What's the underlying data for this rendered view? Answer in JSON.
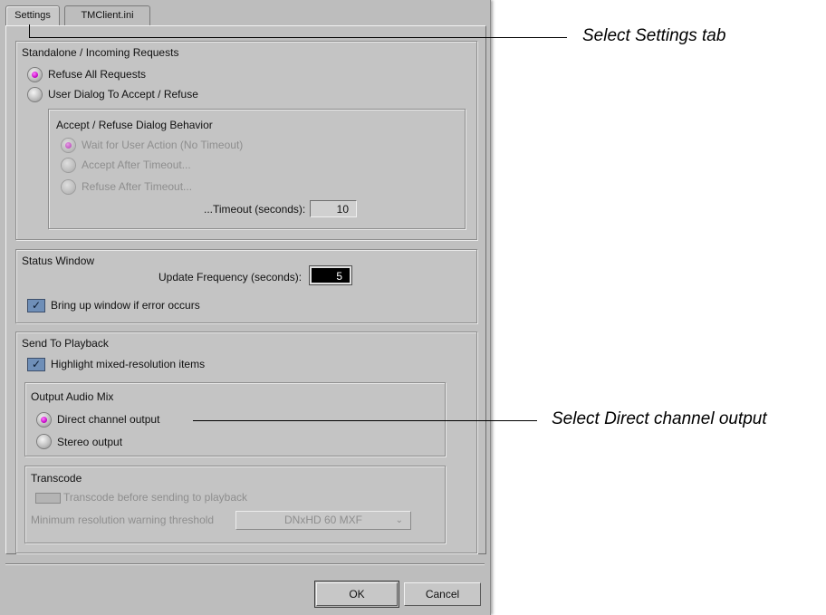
{
  "tabs": [
    {
      "label": "Settings",
      "active": true
    },
    {
      "label": "TMClient.ini",
      "active": false
    }
  ],
  "standalone": {
    "title": "Standalone / Incoming Requests",
    "options": [
      {
        "label": "Refuse All Requests",
        "selected": true
      },
      {
        "label": "User Dialog To Accept / Refuse",
        "selected": false
      }
    ],
    "dialog_behavior": {
      "title": "Accept / Refuse Dialog Behavior",
      "options": [
        {
          "label": "Wait for User Action (No Timeout)",
          "selected": true
        },
        {
          "label": "Accept After Timeout...",
          "selected": false
        },
        {
          "label": "Refuse After Timeout...",
          "selected": false
        }
      ],
      "timeout_label": "...Timeout (seconds):",
      "timeout_value": "10"
    }
  },
  "status_window": {
    "title": "Status Window",
    "update_label": "Update Frequency (seconds):",
    "update_value": "5",
    "bring_up_label": "Bring up window if error occurs",
    "bring_up_checked": true
  },
  "send_to_playback": {
    "title": "Send To Playback",
    "highlight_label": "Highlight mixed-resolution items",
    "highlight_checked": true,
    "output_audio_mix": {
      "title": "Output Audio Mix",
      "options": [
        {
          "label": "Direct channel output",
          "selected": true
        },
        {
          "label": "Stereo output",
          "selected": false
        }
      ]
    },
    "transcode": {
      "title": "Transcode",
      "checkbox_label": "Transcode before sending to playback",
      "checked": false,
      "threshold_label": "Minimum resolution warning threshold",
      "threshold_value": "DNxHD 60  MXF"
    }
  },
  "buttons": {
    "ok": "OK",
    "cancel": "Cancel"
  },
  "callouts": {
    "settings_tab": "Select Settings tab",
    "direct_output": "Select Direct channel output"
  }
}
